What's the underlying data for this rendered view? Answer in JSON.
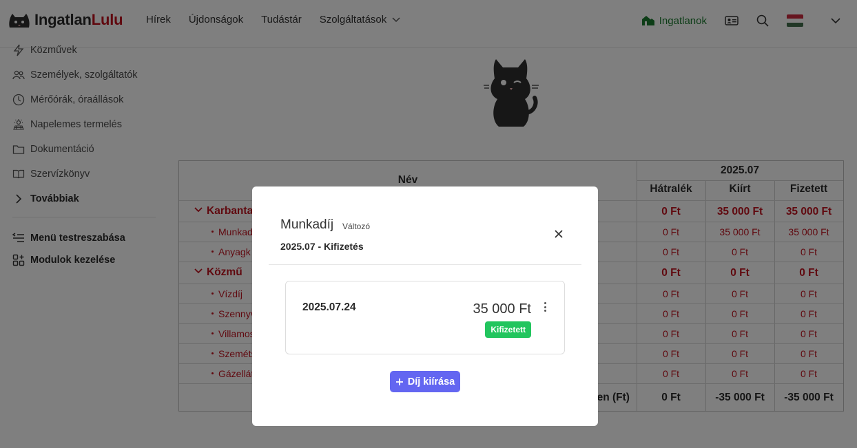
{
  "brand": {
    "part1": "Ingatlan",
    "part2": "Lulu"
  },
  "nav": {
    "items": [
      "Hírek",
      "Újdonságok",
      "Tudástár",
      "Szolgáltatások"
    ]
  },
  "header": {
    "properties_label": "Ingatlanok"
  },
  "sidebar": {
    "items": [
      {
        "label": "Közművek",
        "icon": "lightning-icon"
      },
      {
        "label": "Személyek, szolgáltatók",
        "icon": "people-icon"
      },
      {
        "label": "Mérőórák, óraállások",
        "icon": "clock-icon"
      },
      {
        "label": "Napelemes termelés",
        "icon": "solar-icon"
      },
      {
        "label": "Dokumentáció",
        "icon": "folder-icon"
      },
      {
        "label": "Szervízkönyv",
        "icon": "book-icon"
      },
      {
        "label": "Továbbiak",
        "icon": "chevron-right-icon"
      }
    ],
    "bottom": [
      {
        "label": "Menü testreszabása",
        "icon": "list-icon"
      },
      {
        "label": "Modulok kezelése",
        "icon": "modules-icon"
      }
    ]
  },
  "table": {
    "col_name": "Név",
    "period": "2025.07",
    "col_arrears": "Hátralék",
    "col_issued": "Kiírt",
    "col_paid": "Fizetett",
    "rows": [
      {
        "type": "group",
        "name": "Karbanta",
        "arrears": "0 Ft",
        "issued": "35 000 Ft",
        "paid": "35 000 Ft"
      },
      {
        "type": "item",
        "name": "Munkad",
        "arrears": "0 Ft",
        "issued": "35 000 Ft",
        "paid": "35 000 Ft"
      },
      {
        "type": "item",
        "name": "Anyagk",
        "arrears": "0 Ft",
        "issued": "0 Ft",
        "paid": "0 Ft"
      },
      {
        "type": "group",
        "name": "Közmű",
        "arrears": "0 Ft",
        "issued": "0 Ft",
        "paid": "0 Ft"
      },
      {
        "type": "item",
        "name": "Vízdíj",
        "arrears": "0 Ft",
        "issued": "0 Ft",
        "paid": "0 Ft"
      },
      {
        "type": "item",
        "name": "Szennyv",
        "arrears": "0 Ft",
        "issued": "0 Ft",
        "paid": "0 Ft"
      },
      {
        "type": "item",
        "name": "Villamos",
        "arrears": "0 Ft",
        "issued": "0 Ft",
        "paid": "0 Ft"
      },
      {
        "type": "item",
        "name": "Szeméts",
        "arrears": "0 Ft",
        "issued": "0 Ft",
        "paid": "0 Ft"
      },
      {
        "type": "item",
        "name": "Gázellát",
        "arrears": "0 Ft",
        "issued": "0 Ft",
        "paid": "0 Ft"
      }
    ],
    "total": {
      "label": "sen (Ft)",
      "arrears": "0 Ft",
      "issued": "-35 000 Ft",
      "paid": "-35 000 Ft"
    }
  },
  "modal": {
    "title": "Munkadíj",
    "badge": "Változó",
    "subtitle": "2025.07 - Kifizetés",
    "payment": {
      "date": "2025.07.24",
      "amount": "35 000 Ft",
      "status": "Kifizetett"
    },
    "add_button": "Díj kiírása"
  },
  "colors": {
    "accent": "#6366f1",
    "brand_red": "#c1121f",
    "success": "#22c55e",
    "property_green": "#1b7a2e"
  }
}
